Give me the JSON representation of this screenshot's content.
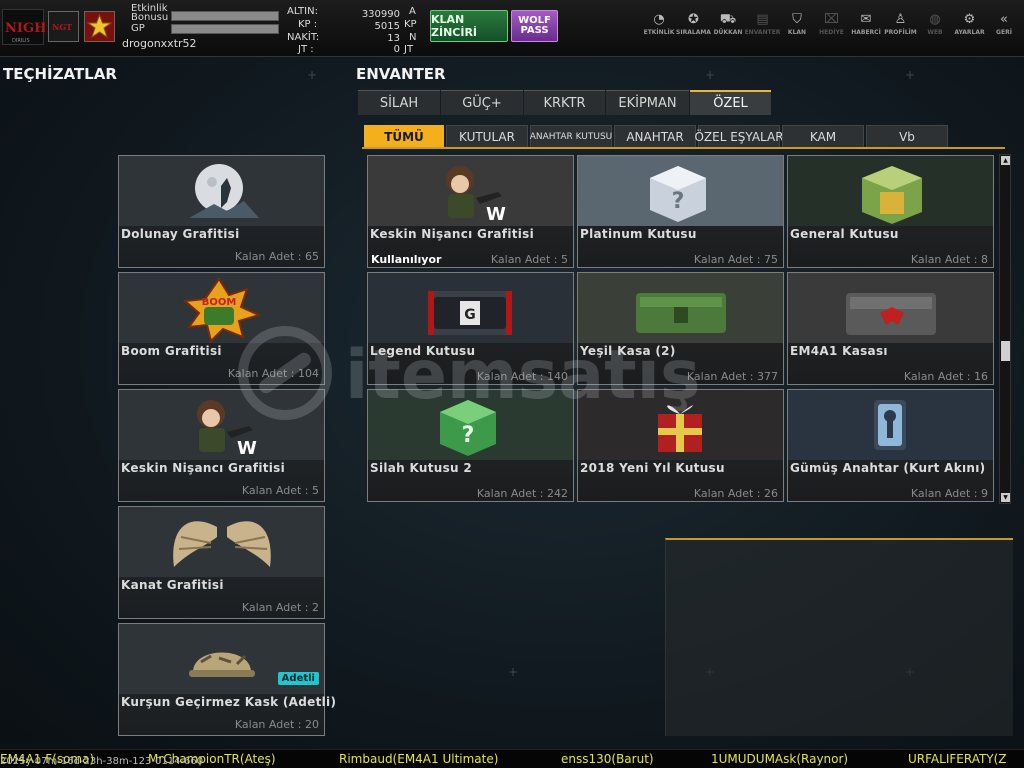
{
  "header": {
    "rank_labels": {
      "event_line1": "Etkinlik",
      "event_line2": "Bonusu",
      "gp": "GP"
    },
    "username": "drogonxxtr52",
    "currencies": [
      {
        "label": "ALTIN:",
        "value": "330990",
        "unit": "A"
      },
      {
        "label": "KP :",
        "value": "5015",
        "unit": "KP"
      },
      {
        "label": "NAKİT:",
        "value": "13",
        "unit": "N"
      },
      {
        "label": "JT :",
        "value": "0",
        "unit": "JT"
      }
    ],
    "klan_button": "KLAN ZİNCİRİ",
    "wolf_pass": "WOLF PASS",
    "nav": [
      {
        "label": "ETKİNLİK",
        "icon": "stopwatch-icon",
        "glyph": "◔",
        "enabled": true
      },
      {
        "label": "SIRALAMA",
        "icon": "medal-icon",
        "glyph": "✪",
        "enabled": true
      },
      {
        "label": "DÜKKAN",
        "icon": "cart-icon",
        "glyph": "⛟",
        "enabled": true
      },
      {
        "label": "ENVANTER",
        "icon": "inventory-icon",
        "glyph": "▤",
        "enabled": false
      },
      {
        "label": "KLAN",
        "icon": "shield-icon",
        "glyph": "⛉",
        "enabled": true
      },
      {
        "label": "HEDİYE",
        "icon": "gift-icon",
        "glyph": "⌧",
        "enabled": false
      },
      {
        "label": "HABERCİ",
        "icon": "megaphone-icon",
        "glyph": "✉",
        "enabled": true
      },
      {
        "label": "PROFİLİM",
        "icon": "profile-icon",
        "glyph": "♙",
        "enabled": true
      },
      {
        "label": "WEB",
        "icon": "globe-icon",
        "glyph": "◍",
        "enabled": false
      },
      {
        "label": "AYARLAR",
        "icon": "gear-icon",
        "glyph": "⚙",
        "enabled": true
      },
      {
        "label": "GERİ",
        "icon": "back-icon",
        "glyph": "«",
        "enabled": true
      }
    ]
  },
  "equipment": {
    "title": "TEÇHİZATLAR",
    "items": [
      {
        "name": "Dolunay Grafitisi",
        "qty": "Kalan Adet : 65",
        "icon": "moon-graffiti-icon"
      },
      {
        "name": "Boom Grafitisi",
        "qty": "Kalan Adet : 104",
        "icon": "boom-graffiti-icon"
      },
      {
        "name": "Keskin Nişancı Grafitisi",
        "qty": "Kalan Adet : 5",
        "icon": "sniper-graffiti-icon"
      },
      {
        "name": "Kanat Grafitisi",
        "qty": "Kalan Adet : 2",
        "icon": "wings-graffiti-icon"
      },
      {
        "name": "Kurşun Geçirmez Kask (Adetli)",
        "qty": "Kalan Adet : 20",
        "icon": "helmet-icon",
        "badge": "Adetli"
      }
    ]
  },
  "inventory": {
    "title": "ENVANTER",
    "tabs": [
      "SİLAH",
      "GÜÇ+",
      "KRKTR",
      "EKİPMAN",
      "ÖZEL"
    ],
    "active_tab": 4,
    "subtabs": [
      "TÜMÜ",
      "KUTULAR",
      "ANAHTAR KUTUSU",
      "ANAHTAR",
      "ÖZEL EŞYALAR",
      "KAM",
      "Vb"
    ],
    "active_subtab": 0,
    "items": [
      {
        "name": "Keskin Nişancı Grafitisi",
        "qty": "Kalan Adet : 5",
        "status": "Kullanılıyor",
        "icon": "sniper-graffiti-icon"
      },
      {
        "name": "Platinum Kutusu",
        "qty": "Kalan Adet : 75",
        "icon": "platinum-box-icon"
      },
      {
        "name": "General Kutusu",
        "qty": "Kalan Adet : 8",
        "icon": "general-box-icon"
      },
      {
        "name": "Legend Kutusu",
        "qty": "Kalan Adet : 140",
        "icon": "legend-case-icon"
      },
      {
        "name": "Yeşil Kasa (2)",
        "qty": "Kalan Adet : 377",
        "icon": "green-case-icon"
      },
      {
        "name": "EM4A1 Kasası",
        "qty": "Kalan Adet : 16",
        "icon": "em4a1-case-icon"
      },
      {
        "name": "Silah Kutusu 2",
        "qty": "Kalan Adet : 242",
        "icon": "weapon-box-icon"
      },
      {
        "name": "2018 Yeni Yıl Kutusu",
        "qty": "Kalan Adet : 26",
        "icon": "newyear-box-icon"
      },
      {
        "name": "Gümüş Anahtar (Kurt Akını)",
        "qty": "Kalan Adet : 9",
        "icon": "silver-key-icon"
      }
    ]
  },
  "watermark": "itemsatış",
  "ticker": {
    "timestamp": "2025y-07m-16d-23h-38m-123-0114-660",
    "messages": [
      "EM4A1 F(soma)",
      "MrChampionTR(Ateş)",
      "Rimbaud(EM4A1 Ultimate)",
      "enss130(Barut)",
      "1UMUDUMAsk(Raynor)",
      "URFALIFERATY(Z"
    ]
  }
}
